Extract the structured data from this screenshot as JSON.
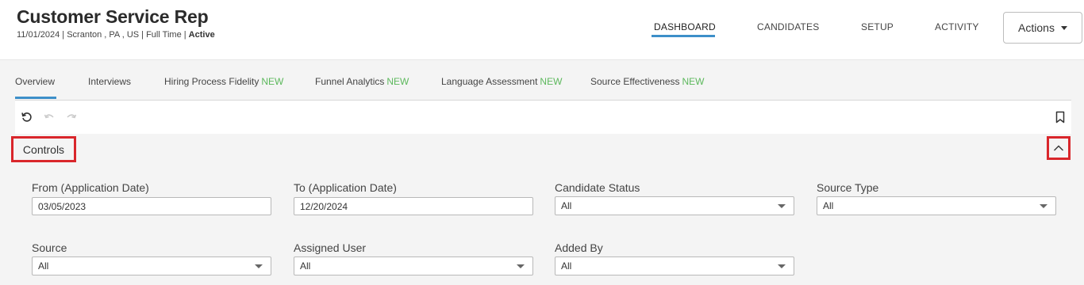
{
  "header": {
    "title": "Customer Service Rep",
    "subtitle_meta": "11/01/2024 | Scranton , PA , US | Full Time |",
    "subtitle_status": "Active",
    "nav": [
      "DASHBOARD",
      "CANDIDATES",
      "SETUP",
      "ACTIVITY"
    ],
    "actions_label": "Actions"
  },
  "subtabs": {
    "items": [
      {
        "label": "Overview",
        "badge": ""
      },
      {
        "label": "Interviews",
        "badge": ""
      },
      {
        "label": "Hiring Process Fidelity",
        "badge": "NEW"
      },
      {
        "label": "Funnel Analytics",
        "badge": "NEW"
      },
      {
        "label": "Language Assessment",
        "badge": "NEW"
      },
      {
        "label": "Source Effectiveness",
        "badge": "NEW"
      }
    ]
  },
  "controls": {
    "title": "Controls",
    "fields": {
      "from_label": "From (Application Date)",
      "from_value": "03/05/2023",
      "to_label": "To (Application Date)",
      "to_value": "12/20/2024",
      "candidate_status_label": "Candidate Status",
      "candidate_status_value": "All",
      "source_type_label": "Source Type",
      "source_type_value": "All",
      "source_label": "Source",
      "source_value": "All",
      "assigned_user_label": "Assigned User",
      "assigned_user_value": "All",
      "added_by_label": "Added By",
      "added_by_value": "All"
    }
  },
  "colors": {
    "accent": "#3d8fc9",
    "new_badge": "#5cb85c",
    "highlight_box": "#d9262b"
  },
  "icons": [
    "undo-reset-icon",
    "undo-icon",
    "redo-icon",
    "bookmark-icon",
    "chevron-up-icon",
    "caret-down-icon"
  ]
}
